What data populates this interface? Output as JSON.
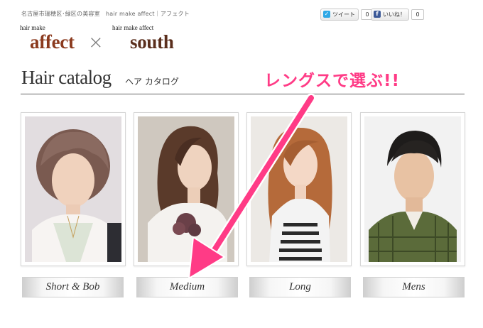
{
  "header": {
    "tagline": "名古屋市瑞穂区･緑区の美容室　hair make affect｜アフェクト",
    "tweet_label": "ツイート",
    "tweet_count": "0",
    "like_label": "いいね！",
    "like_count": "0"
  },
  "logo": {
    "left_small": "hair make",
    "left_big": "affect",
    "separator": "×",
    "right_small": "hair make affect",
    "right_big": "south"
  },
  "catalog": {
    "title": "Hair catalog",
    "subtitle": "ヘア カタログ",
    "callout": "レングスで選ぶ!!"
  },
  "categories": [
    {
      "label": "Short & Bob"
    },
    {
      "label": "Medium"
    },
    {
      "label": "Long"
    },
    {
      "label": "Mens"
    }
  ],
  "colors": {
    "accent_pink": "#ff3b86",
    "logo_brown": "#8b3a1e",
    "logo_south": "#5a2e1c",
    "twitter_blue": "#2ea8e6",
    "facebook_blue": "#3b5998"
  },
  "icons": {
    "tweet": "twitter-bird-icon",
    "like": "facebook-f-icon",
    "arrow": "pink-arrow-icon"
  }
}
